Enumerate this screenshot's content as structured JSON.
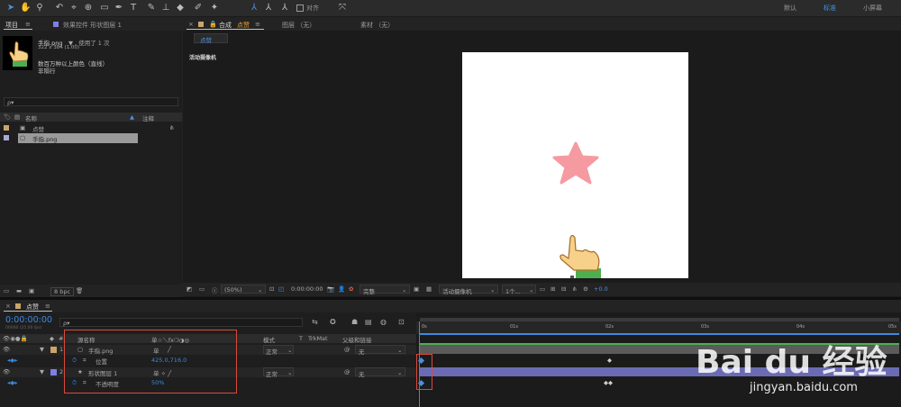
{
  "toolbar": {
    "tools": [
      "selection-tool-icon",
      "hand-tool-icon",
      "zoom-tool-icon",
      "rotate-tool-icon",
      "camera-tool-icon",
      "pan-behind-tool-icon",
      "rectangle-tool-icon",
      "pen-tool-icon",
      "type-tool-icon",
      "brush-tool-icon",
      "clone-stamp-tool-icon",
      "eraser-tool-icon",
      "roto-brush-tool-icon",
      "puppet-tool-icon"
    ],
    "snap_label": "对齐",
    "workspaces": [
      "默认",
      "标准",
      "小屏幕"
    ],
    "active_workspace": "标准"
  },
  "project_panel": {
    "tab_label": "项目",
    "effects_tab_label": "效果控件 形状图层 1",
    "asset_name": "手指.png",
    "asset_usage": "▼ , 使用了 1 次",
    "asset_dims": "322 x 384 (1.00)",
    "asset_color": "数百万种以上颜色（直线）",
    "asset_interlace": "非隔行",
    "search_placeholder": "ρ▾",
    "col_name": "名称",
    "col_comment": "注释",
    "items": [
      {
        "name": "点赞",
        "color": "#c9a56a"
      },
      {
        "name": "手指.png",
        "color": "#a9a9d6"
      }
    ],
    "bpc_label": "8 bpc"
  },
  "comp_panel": {
    "tab_comp_prefix": "合成",
    "tab_comp_name": "点赞",
    "tab_layer": "图层 （无）",
    "tab_footage": "素材 （无）",
    "breadcrumb": "点赞",
    "camera_label": "活动摄像机",
    "zoom": "(50%)",
    "timecode": "0:00:00:00",
    "resolution": "完整",
    "view_camera": "活动摄像机",
    "view_count": "1个...",
    "exposure": "+0.0",
    "shape_color": "#f59aa1"
  },
  "timeline": {
    "tab_label": "点赞",
    "current_time": "0:00:00:00",
    "fps_note": "00000 (25.00 fps)",
    "search_placeholder": "ρ▾",
    "col_source": "源名称",
    "col_mode": "模式",
    "col_t": "T",
    "col_trkmat": "TrkMat",
    "col_parent": "父级和链接",
    "switches_header": "单☆＼fx❍◑◎",
    "layers": [
      {
        "num": "1",
        "name": "手指.png",
        "color": "#c9a56a",
        "mode": "正常",
        "parent": "无",
        "prop_name": "位置",
        "prop_value": "425.0,716.0"
      },
      {
        "num": "2",
        "name": "形状图层 1",
        "color": "#7f7fe6",
        "mode": "正常",
        "parent": "无",
        "prop_name": "不透明度",
        "prop_value": "50%"
      }
    ],
    "ruler_ticks": [
      "0s",
      "01s",
      "02s",
      "03s",
      "04s",
      "05s"
    ]
  },
  "watermark": {
    "brand": "Bai du 经验",
    "url": "jingyan.baidu.com"
  }
}
